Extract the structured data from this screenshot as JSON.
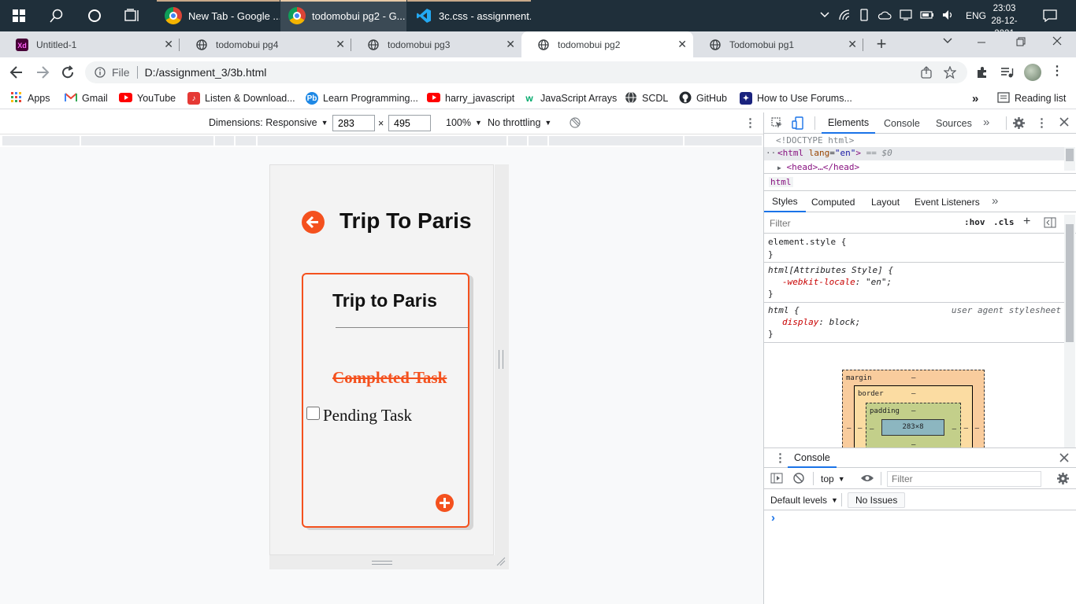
{
  "taskbar": {
    "apps": [
      {
        "label": "New Tab - Google ...",
        "icon": "chrome-icon"
      },
      {
        "label": "todomobui pg2 - G...",
        "icon": "chrome-icon"
      },
      {
        "label": "3c.css - assignment...",
        "icon": "vscode-icon"
      }
    ],
    "lang": "ENG",
    "time": "23:03",
    "date": "28-12-2021"
  },
  "tabs": [
    {
      "title": "Untitled-1",
      "icon": "adobe-xd-icon"
    },
    {
      "title": "todomobui pg4",
      "icon": "globe-icon"
    },
    {
      "title": "todomobui pg3",
      "icon": "globe-icon"
    },
    {
      "title": "todomobui pg2",
      "icon": "globe-icon"
    },
    {
      "title": "Todomobui pg1",
      "icon": "globe-icon"
    }
  ],
  "toolbar": {
    "scheme": "File",
    "url": "D:/assignment_3/3b.html"
  },
  "bookmarks": [
    {
      "label": "Apps"
    },
    {
      "label": "Gmail"
    },
    {
      "label": "YouTube"
    },
    {
      "label": "Listen & Download..."
    },
    {
      "label": "Learn Programming..."
    },
    {
      "label": "harry_javascript"
    },
    {
      "label": "JavaScript Arrays"
    },
    {
      "label": "SCDL"
    },
    {
      "label": "GitHub"
    },
    {
      "label": "How to Use Forums..."
    }
  ],
  "reading_list": "Reading list",
  "device_toolbar": {
    "dimensions_label": "Dimensions: Responsive",
    "width": "283",
    "height": "495",
    "times": "×",
    "zoom": "100%",
    "throttle": "No throttling"
  },
  "app": {
    "header_title": "Trip To Paris",
    "card_title": "Trip to Paris",
    "completed_task": "Completed Task",
    "pending_task": "Pending Task",
    "pending_checked": false,
    "accent_color": "#f4511e"
  },
  "devtools": {
    "tabs": [
      "Elements",
      "Console",
      "Sources"
    ],
    "active_tab": "Elements",
    "dom": {
      "doctype": "<!DOCTYPE html>",
      "html_open": "<html",
      "html_attr": "lang",
      "html_attr_value": "\"en\"",
      "html_close": ">",
      "eq0": "== $0",
      "head": "<head>…</head>",
      "ellipsis": "···"
    },
    "breadcrumb": "html",
    "styles_tabs": [
      "Styles",
      "Computed",
      "Layout",
      "Event Listeners"
    ],
    "filter_placeholder": "Filter",
    "hov": ":hov",
    "cls": ".cls",
    "rules": [
      {
        "selector": "element.style {",
        "decls": [],
        "end": "}",
        "source": ""
      },
      {
        "selector": "html[Attributes Style] {",
        "decls": [
          {
            "prop": "-webkit-locale",
            "value": "\"en\";"
          }
        ],
        "end": "}",
        "source": ""
      },
      {
        "selector": "html {",
        "decls": [
          {
            "prop": "display",
            "value": "block;"
          }
        ],
        "end": "}",
        "source": "user agent stylesheet"
      }
    ],
    "boxmodel": {
      "margin_label": "margin",
      "border_label": "border",
      "padding_label": "padding",
      "dash": "–",
      "content": "283×8"
    },
    "drawer": {
      "title": "Console",
      "context": "top",
      "filter_placeholder": "Filter",
      "levels": "Default levels",
      "issues": "No Issues",
      "prompt": "›"
    }
  }
}
